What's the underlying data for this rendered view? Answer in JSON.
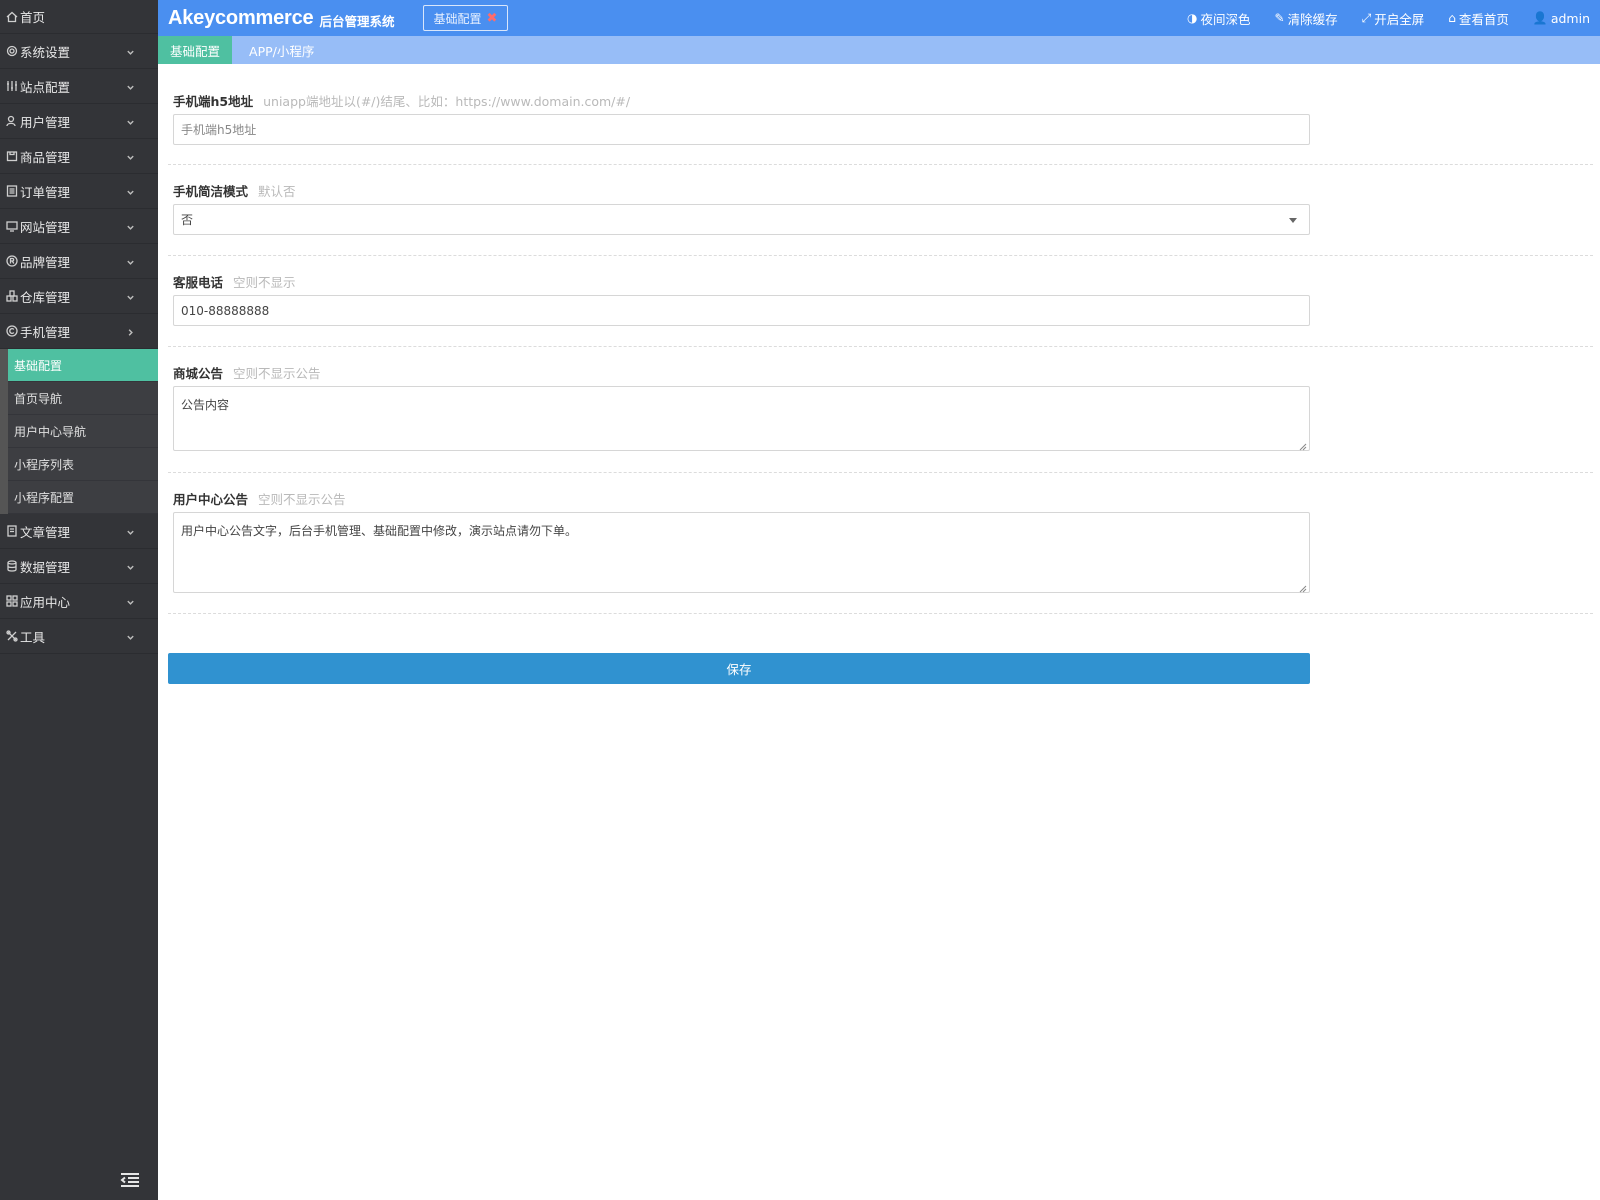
{
  "sidebar": {
    "home": "首页",
    "items": [
      {
        "label": "系统设置",
        "icon": "gear-icon"
      },
      {
        "label": "站点配置",
        "icon": "sliders-icon"
      },
      {
        "label": "用户管理",
        "icon": "user-icon"
      },
      {
        "label": "商品管理",
        "icon": "goods-icon"
      },
      {
        "label": "订单管理",
        "icon": "list-icon"
      },
      {
        "label": "网站管理",
        "icon": "web-icon"
      },
      {
        "label": "品牌管理",
        "icon": "registered-icon"
      },
      {
        "label": "仓库管理",
        "icon": "warehouse-icon"
      },
      {
        "label": "手机管理",
        "icon": "copyright-icon"
      }
    ],
    "sub_items": [
      "基础配置",
      "首页导航",
      "用户中心导航",
      "小程序列表",
      "小程序配置"
    ],
    "items_after": [
      {
        "label": "文章管理",
        "icon": "article-icon"
      },
      {
        "label": "数据管理",
        "icon": "database-icon"
      },
      {
        "label": "应用中心",
        "icon": "apps-icon"
      },
      {
        "label": "工具",
        "icon": "tools-icon"
      }
    ]
  },
  "header": {
    "brand": "Akeycommerce",
    "brand_sub": "后台管理系统",
    "open_tab": "基础配置",
    "close_symbol": "✖",
    "buttons": [
      {
        "label": "夜间深色",
        "icon": "◑"
      },
      {
        "label": "清除缓存",
        "icon": "✎"
      },
      {
        "label": "开启全屏",
        "icon": "⤢"
      },
      {
        "label": "查看首页",
        "icon": "⌂"
      },
      {
        "label": "admin",
        "icon": "👤"
      }
    ]
  },
  "tabs": [
    "基础配置",
    "APP/小程序"
  ],
  "form": {
    "h5": {
      "label": "手机端h5地址",
      "hint": "uniapp端地址以(#/)结尾、比如：https://www.domain.com/#/",
      "placeholder": "手机端h5地址"
    },
    "simple": {
      "label": "手机简洁模式",
      "hint": "默认否",
      "value": "否"
    },
    "phone": {
      "label": "客服电话",
      "hint": "空则不显示",
      "value": "010-88888888"
    },
    "notice": {
      "label": "商城公告",
      "hint": "空则不显示公告",
      "value": "公告内容"
    },
    "user_notice": {
      "label": "用户中心公告",
      "hint": "空则不显示公告",
      "value": "用户中心公告文字，后台手机管理、基础配置中修改，演示站点请勿下单。"
    },
    "save": "保存"
  }
}
